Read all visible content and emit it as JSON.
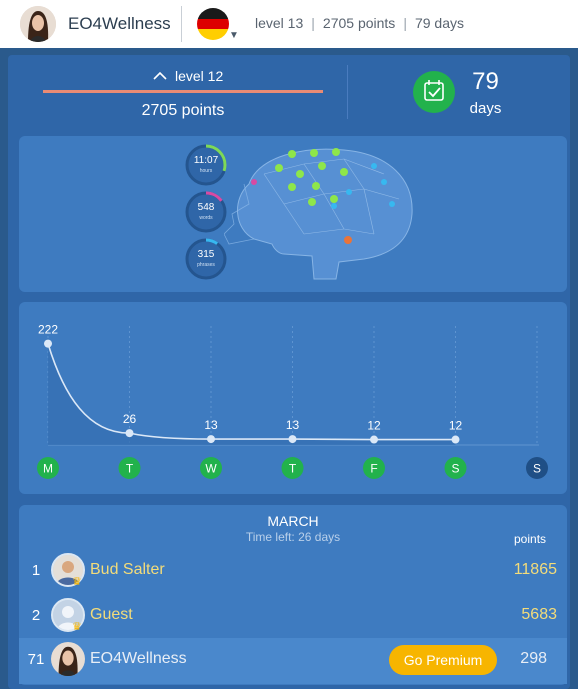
{
  "header": {
    "username": "EO4Wellness",
    "level": "level 13",
    "points": "2705 points",
    "days": "79 days",
    "flag_country": "germany-flag-icon"
  },
  "summary": {
    "level_label": "level 12",
    "points_label": "2705 points",
    "days_value": "79",
    "days_label": "days",
    "accent_color": "#22b24c",
    "progress_color": "#e98b74"
  },
  "brain_stats": [
    {
      "value": "11:07",
      "unit": "hours",
      "color": "#7ed957",
      "fraction": 0.3
    },
    {
      "value": "548",
      "unit": "words",
      "color": "#d84aa3",
      "fraction": 0.15
    },
    {
      "value": "315",
      "unit": "phrases",
      "color": "#37b8f0",
      "fraction": 0.1
    }
  ],
  "chart_data": {
    "type": "area",
    "categories": [
      "M",
      "T",
      "W",
      "T",
      "F",
      "S",
      "S"
    ],
    "values": [
      222,
      26,
      13,
      13,
      12,
      12,
      null
    ],
    "completed": [
      true,
      true,
      true,
      true,
      true,
      true,
      false
    ],
    "ylim": [
      0,
      240
    ],
    "grid": true
  },
  "leaderboard": {
    "title": "MARCH",
    "subtitle": "Time left: 26 days",
    "points_header": "points",
    "rows": [
      {
        "rank": "1",
        "name": "Bud Salter",
        "score": "11865"
      },
      {
        "rank": "2",
        "name": "Guest",
        "score": "5683"
      }
    ],
    "me": {
      "rank": "71",
      "name": "EO4Wellness",
      "score": "298",
      "button": "Go Premium"
    }
  }
}
